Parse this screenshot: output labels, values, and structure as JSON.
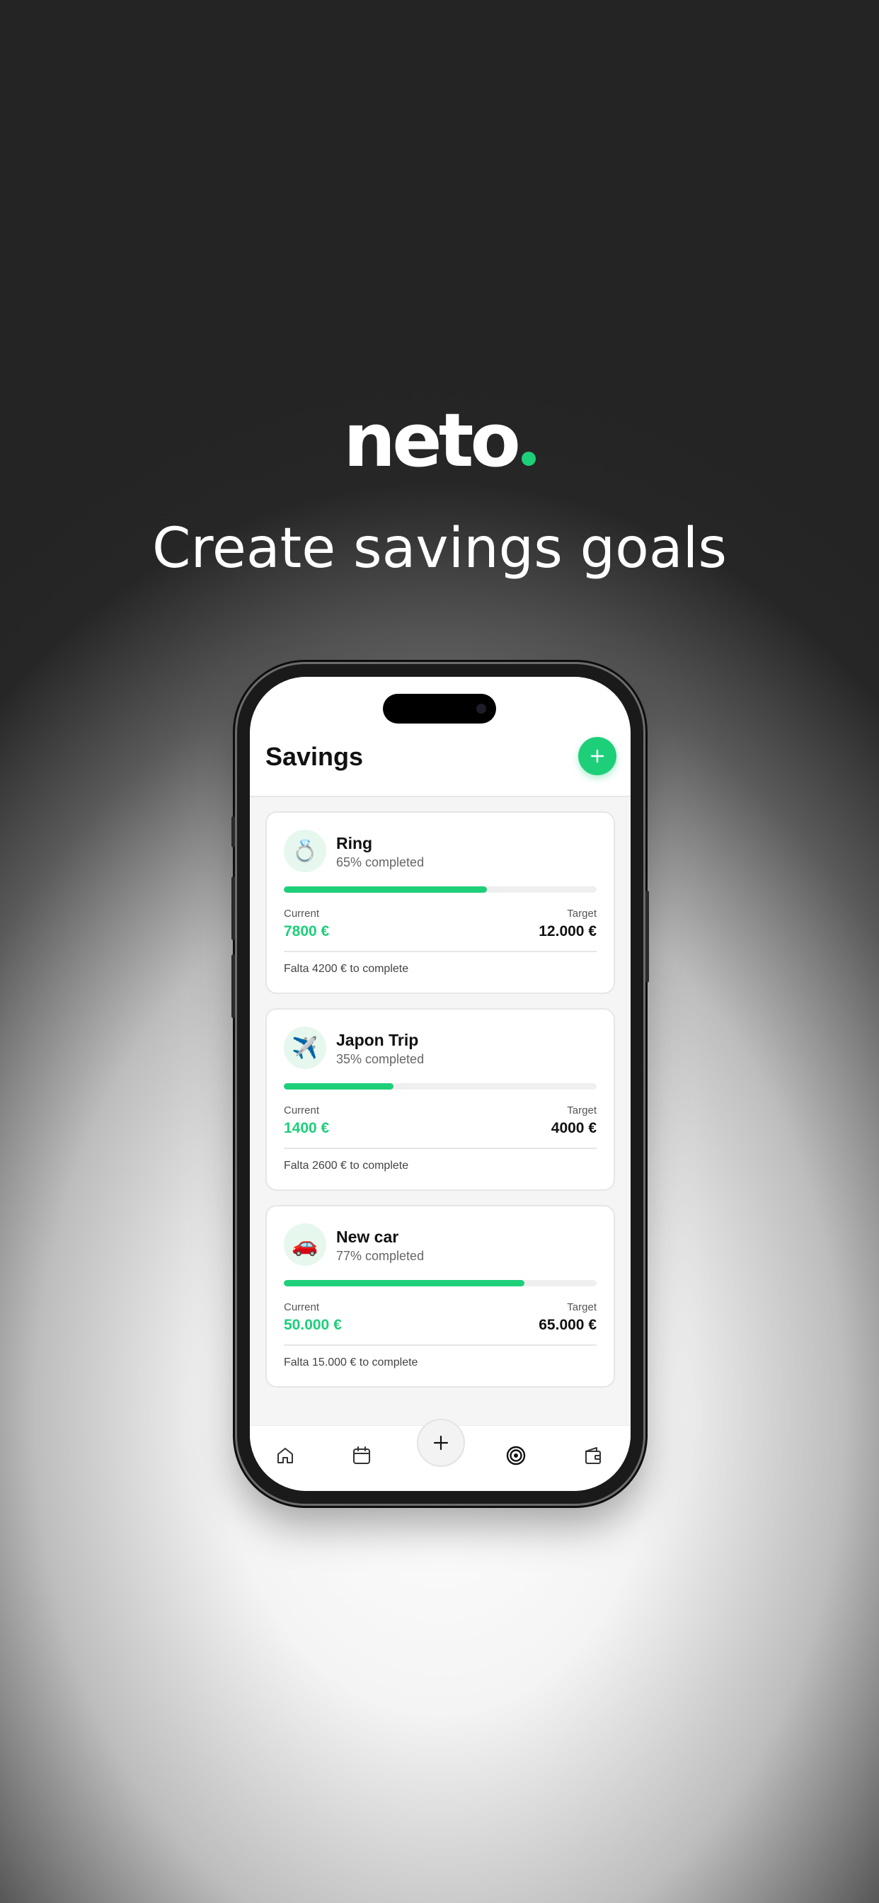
{
  "brand": {
    "wordmark": "neto",
    "accent_color": "#1ecf7a"
  },
  "headline": "Create savings goals",
  "screen": {
    "title": "Savings",
    "add_button_icon": "plus-icon",
    "labels": {
      "current": "Current",
      "target": "Target"
    },
    "goals": [
      {
        "icon": "ring-icon",
        "emoji": "💍",
        "name": "Ring",
        "completed_text": "65% completed",
        "progress": 0.65,
        "current": "7800 €",
        "target": "12.000 €",
        "remaining_text": "Falta 4200 € to complete"
      },
      {
        "icon": "airplane-icon",
        "emoji": "✈️",
        "name": "Japon Trip",
        "completed_text": "35% completed",
        "progress": 0.35,
        "current": "1400 €",
        "target": "4000 €",
        "remaining_text": "Falta 2600 € to complete"
      },
      {
        "icon": "car-icon",
        "emoji": "🚗",
        "name": "New car",
        "completed_text": "77% completed",
        "progress": 0.77,
        "current": "50.000 €",
        "target": "65.000 €",
        "remaining_text": "Falta 15.000 € to complete"
      }
    ],
    "tabbar": [
      "home-icon",
      "calendar-icon",
      "plus-icon",
      "target-icon",
      "wallet-icon"
    ]
  }
}
